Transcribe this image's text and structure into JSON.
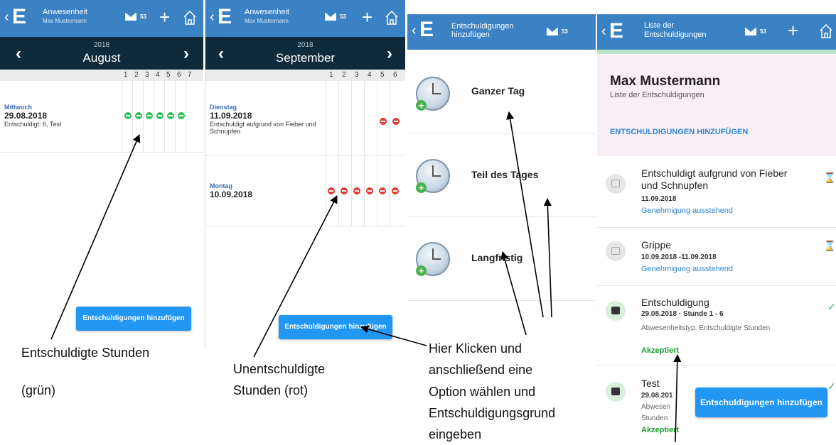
{
  "app": {
    "logo": "E",
    "back": "‹",
    "mail_count": "53",
    "plus": "+"
  },
  "panel1": {
    "title": "Anwesenheit",
    "subtitle": "Max Mustermann",
    "year": "2018",
    "month": "August",
    "prev": "‹",
    "next": "›",
    "periods": [
      "1",
      "2",
      "3",
      "4",
      "5",
      "6",
      "7"
    ],
    "entry": {
      "day": "Mittwoch",
      "date": "29.08.2018",
      "note": "Entschuldigt: 6, Test"
    },
    "button": "Entschuldigungen hinzufügen"
  },
  "panel2": {
    "title": "Anwesenheit",
    "subtitle": "Max Mustermann",
    "year": "2018",
    "month": "September",
    "prev": "‹",
    "next": "›",
    "periods": [
      "1",
      "2",
      "3",
      "4",
      "5",
      "6"
    ],
    "entries": [
      {
        "day": "Dienstag",
        "date": "11.09.2018",
        "note": "Entschuldigt aufgrund von Fieber und Schnupfen"
      },
      {
        "day": "Montag",
        "date": "10.09.2018",
        "note": ""
      }
    ],
    "button": "Entschuldigungen hinzufügen"
  },
  "panel3": {
    "title_line1": "Entschuldigungen",
    "title_line2": "hinzufügen",
    "options": [
      "Ganzer Tag",
      "Teil des Tages",
      "Langfristig"
    ]
  },
  "panel4": {
    "title_line1": "Liste der",
    "title_line2": "Entschuldigungen",
    "name": "Max Mustermann",
    "subtitle": "Liste der Entschuldigungen",
    "add_link": "ENTSCHULDIGUNGEN HINZUFÜGEN",
    "items": [
      {
        "title": "Entschuldigt aufgrund von Fieber und Schnupfen",
        "date": "11.09.2018",
        "status": "Genehmigung ausstehend"
      },
      {
        "title": "Grippe",
        "date": "10.09.2018 -11.09.2018",
        "status": "Genehmigung ausstehend"
      },
      {
        "title": "Entschuldigung",
        "date": "29.08.2018 · Stunde 1 - 6",
        "detail": "Abwesenheitstyp: Entschuldigte Stunden",
        "status": "Akzeptiert"
      },
      {
        "title": "Test",
        "date": "29.08.201",
        "detail1": "Abwesen",
        "detail2": "Stunden",
        "status": "Akzeptiert"
      }
    ],
    "fab": "Entschuldigungen hinzufügen"
  },
  "captions": {
    "c1_line1": "Entschuldigte Stunden",
    "c1_line2": "(grün)",
    "c2_line1": "Unentschuldigte",
    "c2_line2": "Stunden (rot)",
    "c3": [
      "Hier Klicken und",
      "anschließend eine",
      "Option wählen und",
      "Entschuldigungsgrund",
      "eingeben"
    ]
  },
  "colors": {
    "topbar": "#3b82c4",
    "monthbar": "#0f2a3a",
    "green": "#2fbf5b",
    "red": "#e53935",
    "button": "#2196f3"
  }
}
